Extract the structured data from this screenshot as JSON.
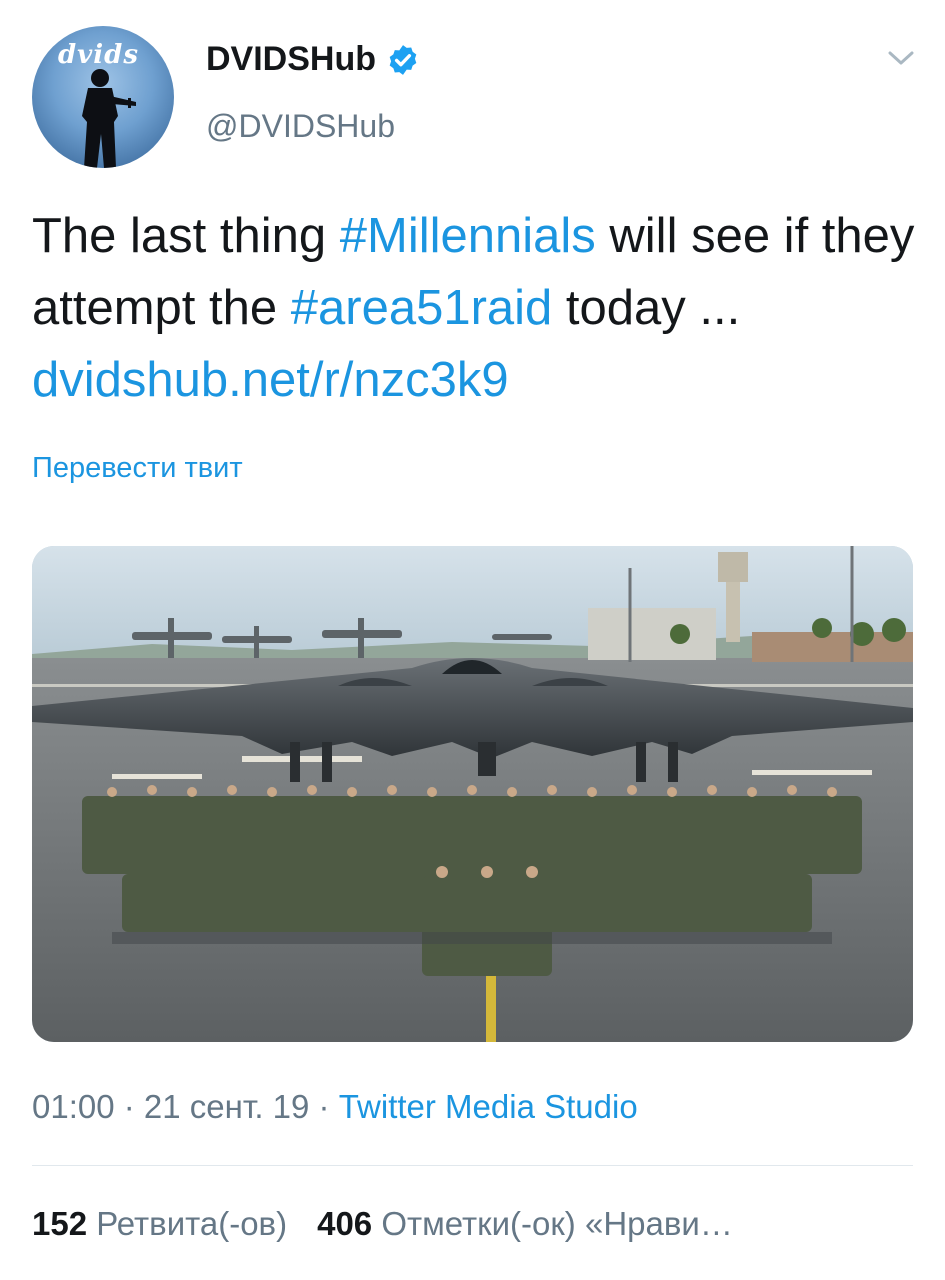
{
  "author": {
    "avatar_logo": "dvids",
    "display_name": "DVIDSHub",
    "handle": "@DVIDSHub",
    "verified": true
  },
  "tweet": {
    "text_1": "The last thing ",
    "hashtag_1": "#Millennials",
    "text_2": " will see if they attempt the ",
    "hashtag_2": "#area51raid",
    "text_3": " today ... ",
    "link": "dvidshub.net/r/nzc3k9"
  },
  "translate_label": "Перевести твит",
  "media": {
    "description": "photo-airfield-bomber-crew"
  },
  "meta": {
    "time": "01:00",
    "sep1": " · ",
    "date": "21 сент. 19",
    "sep2": " · ",
    "source": "Twitter Media Studio"
  },
  "stats": {
    "retweets_count": "152",
    "retweets_label": "Ретвита(-ов)",
    "likes_count": "406",
    "likes_label": "Отметки(-ок) «Нрави…"
  },
  "colors": {
    "link": "#1b95e0",
    "text": "#14171a",
    "muted": "#657786",
    "divider": "#e1e8ed"
  },
  "icons": [
    "verified-badge-icon",
    "chevron-down-icon"
  ]
}
